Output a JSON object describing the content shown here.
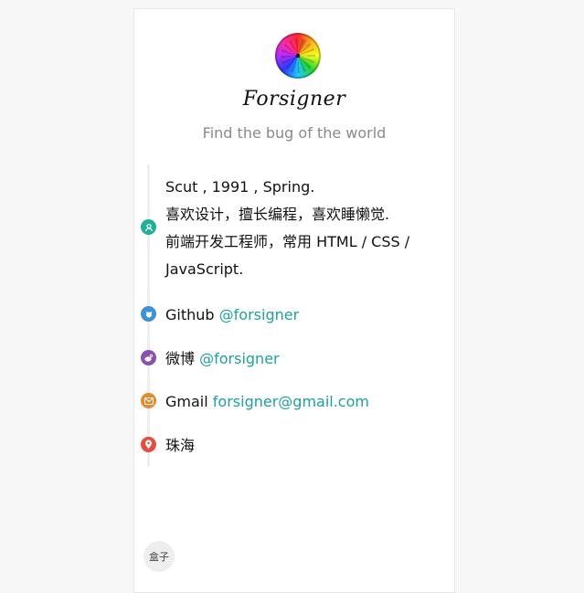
{
  "profile": {
    "name": "Forsigner",
    "tagline": "Find the bug of the world"
  },
  "timeline": {
    "intro": {
      "line1": "Scut , 1991 , Spring.",
      "line2": "喜欢设计，擅长编程，喜欢睡懒觉.",
      "line3": "前端开发工程师，常用 HTML / CSS /",
      "line4": "JavaScript.",
      "icon": "user-icon",
      "color": "#1ab394"
    },
    "github": {
      "label": "Github",
      "link": "@forsigner",
      "icon": "github-icon",
      "color": "#3c93d6"
    },
    "weibo": {
      "label": "微博",
      "link": "@forsigner",
      "icon": "weibo-icon",
      "color": "#8a4fb3"
    },
    "gmail": {
      "label": "Gmail",
      "link": "forsigner@gmail.com",
      "icon": "mail-icon",
      "color": "#e8892a"
    },
    "location": {
      "label": "珠海",
      "icon": "location-icon",
      "color": "#e74c3c"
    }
  },
  "footer": {
    "button_label": "盒子"
  }
}
